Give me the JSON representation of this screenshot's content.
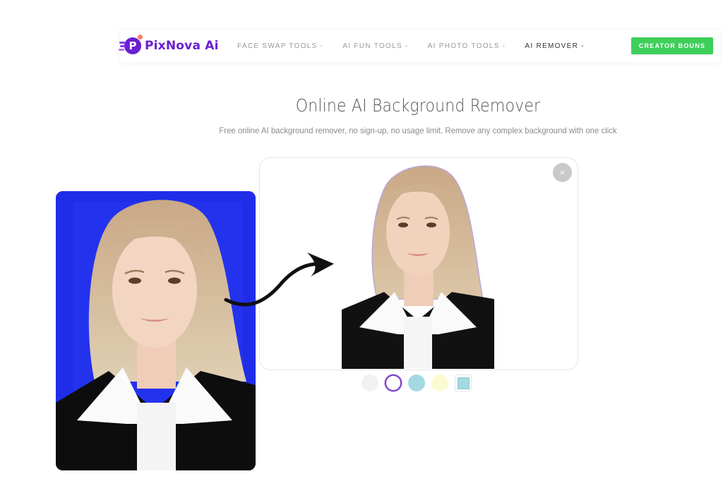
{
  "nav": {
    "logo_letter": "P",
    "logo_text": "PixNova Ai",
    "items": [
      {
        "label": "FACE SWAP TOOLS",
        "caret": "-",
        "active": false
      },
      {
        "label": "AI FUN TOOLS",
        "caret": "-",
        "active": false
      },
      {
        "label": "AI PHOTO TOOLS",
        "caret": "-",
        "active": false
      },
      {
        "label": "AI REMOVER",
        "caret": "-",
        "active": true
      }
    ],
    "cta_label": "CREATOR BOUNS"
  },
  "hero": {
    "title": "Online AI Background Remover",
    "subtitle": "Free online AI background remover, no sign-up, no usage limit. Remove any complex background with one click"
  },
  "original_image": {
    "description": "Portrait of blonde woman in black blazer on blue background",
    "background_color": "#1f2de8"
  },
  "result_image": {
    "description": "Same portrait with background removed"
  },
  "close_icon": "×",
  "background_swatches": [
    {
      "name": "transparent",
      "color": "#f1f1f4",
      "selected": false,
      "shape": "circle"
    },
    {
      "name": "white",
      "color": "#ffffff",
      "selected": true,
      "shape": "circle"
    },
    {
      "name": "light-blue",
      "color": "#a6d8e2",
      "selected": false,
      "shape": "circle"
    },
    {
      "name": "light-yellow",
      "color": "#fbfbd2",
      "selected": false,
      "shape": "circle"
    },
    {
      "name": "custom-image",
      "color": "#a6d8e2",
      "selected": false,
      "shape": "square"
    }
  ],
  "colors": {
    "brand": "#6a1fd0",
    "cta": "#3ecf5a",
    "selected_ring": "#7a3fc8"
  }
}
